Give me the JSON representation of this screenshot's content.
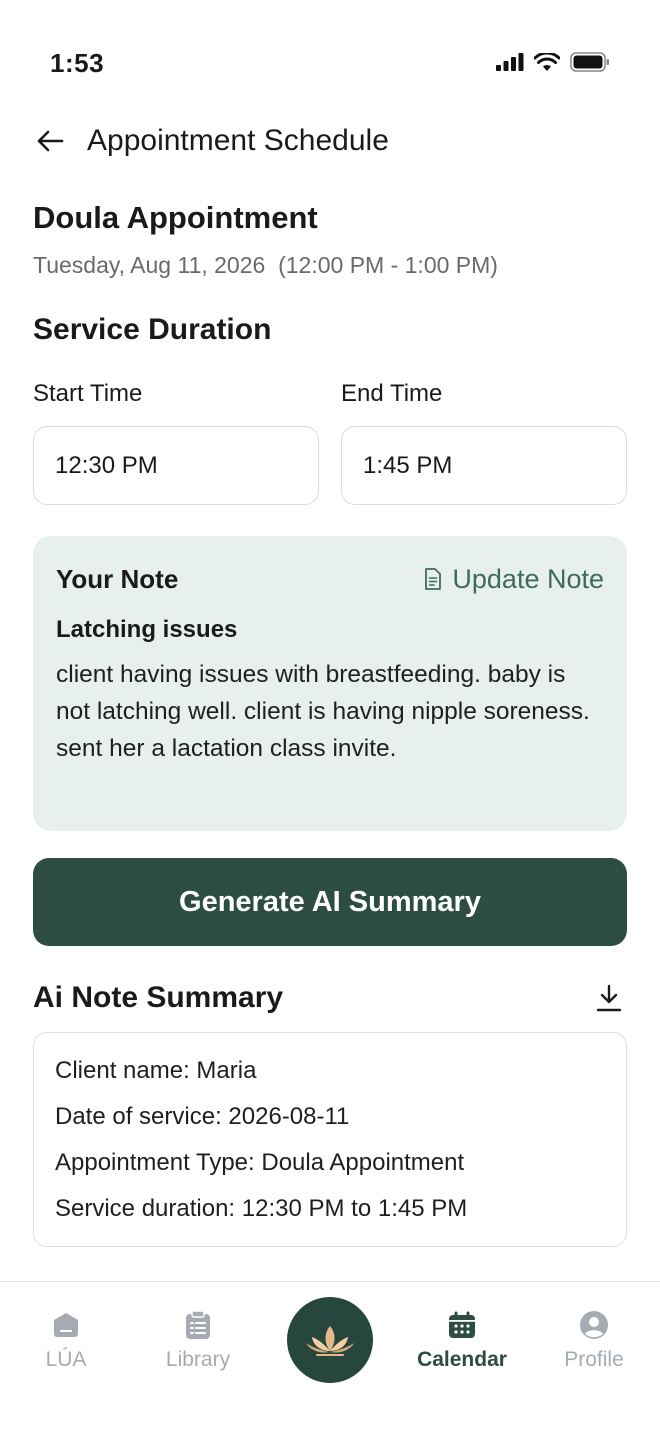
{
  "status_bar": {
    "time": "1:53"
  },
  "header": {
    "title": "Appointment Schedule"
  },
  "appointment": {
    "title": "Doula Appointment",
    "date": "Tuesday, Aug 11, 2026",
    "time_range": "(12:00 PM - 1:00 PM)"
  },
  "service_duration": {
    "title": "Service Duration",
    "start_label": "Start Time",
    "start_value": "12:30 PM",
    "end_label": "End Time",
    "end_value": "1:45 PM"
  },
  "note": {
    "title": "Your Note",
    "update_label": "Update Note",
    "subject": "Latching issues",
    "body": "client having issues with breastfeeding. baby is not latching well. client is having nipple soreness. sent her a lactation class invite."
  },
  "generate_button": {
    "label": "Generate AI Summary"
  },
  "ai_summary": {
    "title": "Ai Note Summary",
    "lines": [
      "Client name: Maria",
      "Date of service: 2026-08-11",
      "Appointment Type: Doula Appointment",
      "Service duration: 12:30 PM to 1:45 PM"
    ]
  },
  "nav": {
    "items": [
      {
        "label": "LÚA",
        "icon": "home-icon",
        "active": false
      },
      {
        "label": "Library",
        "icon": "clipboard-icon",
        "active": false
      },
      {
        "label": "Calendar",
        "icon": "calendar-icon",
        "active": true
      },
      {
        "label": "Profile",
        "icon": "profile-icon",
        "active": false
      }
    ],
    "center_icon": "lotus-icon"
  },
  "colors": {
    "accent": "#2d4d44",
    "note_bg": "#e7f0ee",
    "link": "#3f6b5f",
    "inactive_nav": "#a6abb3"
  }
}
